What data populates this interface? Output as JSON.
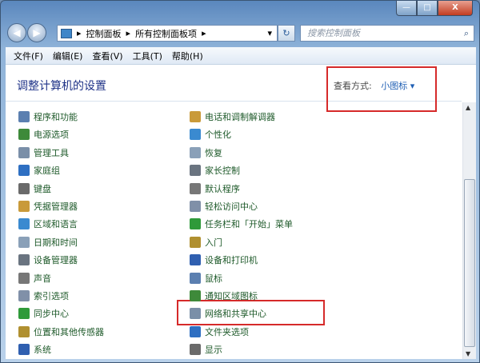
{
  "window": {
    "min": "—",
    "max": "□",
    "close": "X"
  },
  "address": {
    "crumbs": [
      "控制面板",
      "所有控制面板项"
    ],
    "sep": "▸",
    "dropdown": "▾",
    "refresh": "↻"
  },
  "search": {
    "placeholder": "搜索控制面板",
    "icon": "search-icon"
  },
  "menu": [
    "文件(F)",
    "编辑(E)",
    "查看(V)",
    "工具(T)",
    "帮助(H)"
  ],
  "page": {
    "title": "调整计算机的设置",
    "view_by_label": "查看方式:",
    "view_by_value": "小图标",
    "view_by_arrow": "▾"
  },
  "left_items": [
    "程序和功能",
    "电源选项",
    "管理工具",
    "家庭组",
    "键盘",
    "凭据管理器",
    "区域和语言",
    "日期和时间",
    "设备管理器",
    "声音",
    "索引选项",
    "同步中心",
    "位置和其他传感器",
    "系统"
  ],
  "right_items": [
    "电话和调制解调器",
    "个性化",
    "恢复",
    "家长控制",
    "默认程序",
    "轻松访问中心",
    "任务栏和「开始」菜单",
    "入门",
    "设备和打印机",
    "鼠标",
    "通知区域图标",
    "网络和共享中心",
    "文件夹选项",
    "显示"
  ],
  "icon_colors": [
    "#5b7fb0",
    "#3e8a3a",
    "#7a8fa8",
    "#2e6fc2",
    "#6a6a6a",
    "#c99a3a",
    "#3a8ad0",
    "#8aa0b8",
    "#6a7480",
    "#777",
    "#8090a8",
    "#2f9a3a",
    "#b09030",
    "#2f5fb0"
  ],
  "accent": "#d62a2a"
}
